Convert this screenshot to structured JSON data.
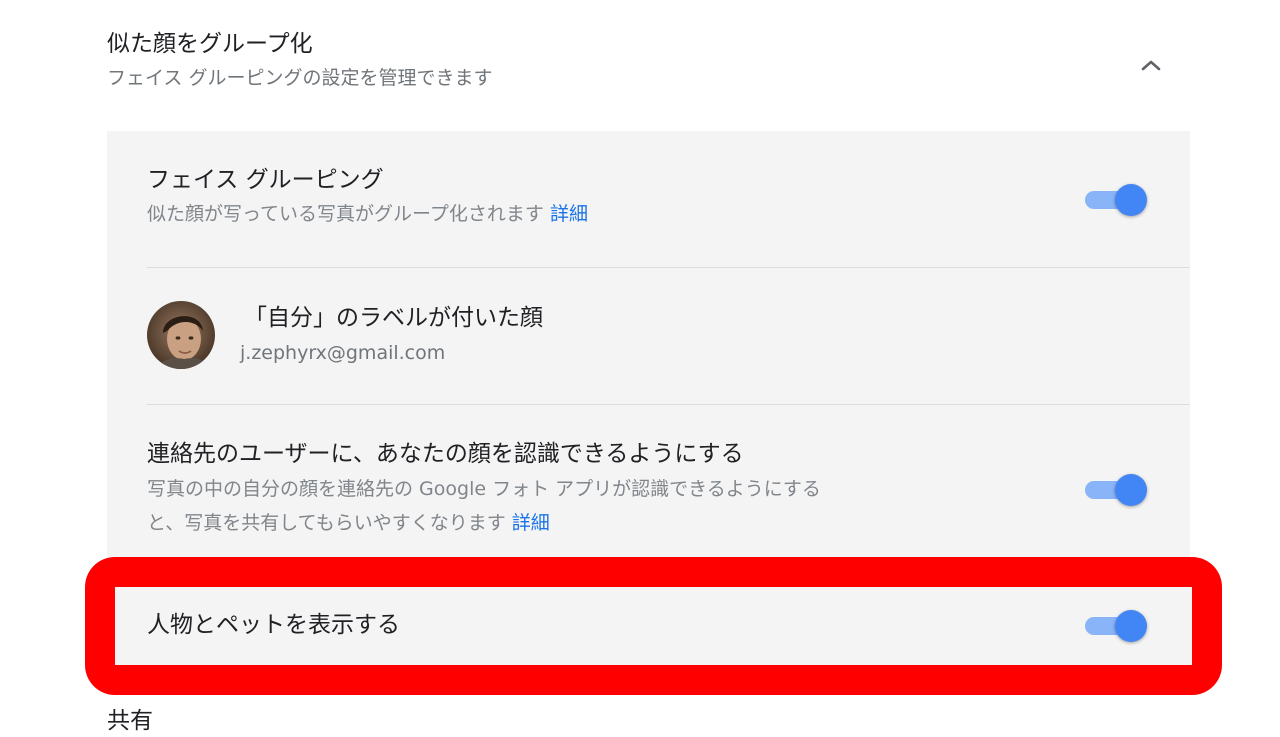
{
  "section": {
    "title": "似た顔をグループ化",
    "subtitle": "フェイス グルーピングの設定を管理できます",
    "collapse_icon": "chevron-up-icon"
  },
  "face_grouping": {
    "title": "フェイス グルーピング",
    "description": "似た顔が写っている写真がグループ化されます",
    "link": "詳細",
    "toggle": "on"
  },
  "self_label": {
    "title": "「自分」のラベルが付いた顔",
    "email": "j.zephyrx@gmail.com"
  },
  "contacts": {
    "title": "連絡先のユーザーに、あなたの顔を認識できるようにする",
    "description_line1": "写真の中の自分の顔を連絡先の Google フォト アプリが認識できるようにする",
    "description_line2": "と、写真を共有してもらいやすくなります",
    "link": "詳細",
    "toggle": "on"
  },
  "pets": {
    "title": "人物とペットを表示する",
    "toggle": "on"
  },
  "next_section": {
    "title": "共有"
  },
  "colors": {
    "toggle_track": "#8ab4f8",
    "toggle_knob": "#4285f4",
    "link": "#1a73e8",
    "highlight": "#ff0000",
    "panel_bg": "#f4f4f4"
  }
}
